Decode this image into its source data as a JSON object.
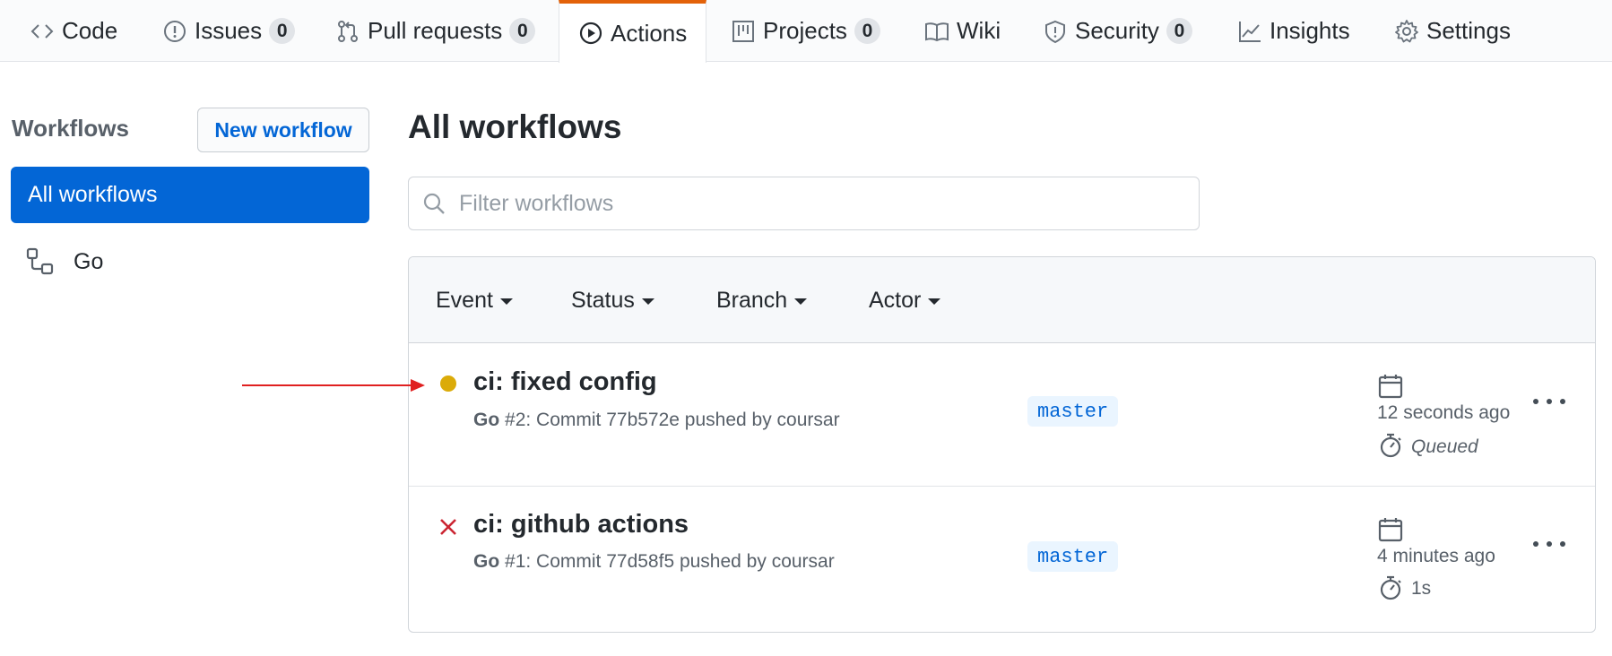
{
  "nav": {
    "tabs": [
      {
        "label": "Code",
        "icon": "code-icon"
      },
      {
        "label": "Issues",
        "icon": "issue-icon",
        "count": "0"
      },
      {
        "label": "Pull requests",
        "icon": "pull-request-icon",
        "count": "0"
      },
      {
        "label": "Actions",
        "icon": "play-icon",
        "active": true
      },
      {
        "label": "Projects",
        "icon": "project-icon",
        "count": "0"
      },
      {
        "label": "Wiki",
        "icon": "book-icon"
      },
      {
        "label": "Security",
        "icon": "shield-icon",
        "count": "0"
      },
      {
        "label": "Insights",
        "icon": "graph-icon"
      },
      {
        "label": "Settings",
        "icon": "gear-icon"
      }
    ],
    "active_accent": "#e36209"
  },
  "sidebar": {
    "title": "Workflows",
    "new_workflow_label": "New workflow",
    "items": [
      {
        "label": "All workflows",
        "selected": true
      },
      {
        "label": "Go",
        "icon": "workflow-icon"
      }
    ]
  },
  "main": {
    "title": "All workflows",
    "filter": {
      "placeholder": "Filter workflows",
      "value": ""
    },
    "filters": [
      "Event",
      "Status",
      "Branch",
      "Actor"
    ],
    "runs": [
      {
        "status": "queued",
        "status_color": "#dbab09",
        "title": "ci: fixed config",
        "workflow": "Go",
        "subtitle": "#2: Commit 77b572e pushed by coursar",
        "branch": "master",
        "time": "12 seconds ago",
        "duration": "Queued"
      },
      {
        "status": "failure",
        "status_color": "#cb2431",
        "title": "ci: github actions",
        "workflow": "Go",
        "subtitle": "#1: Commit 77d58f5 pushed by coursar",
        "branch": "master",
        "time": "4 minutes ago",
        "duration": "1s"
      }
    ]
  },
  "annotation": {
    "arrow_color": "#e02020"
  }
}
